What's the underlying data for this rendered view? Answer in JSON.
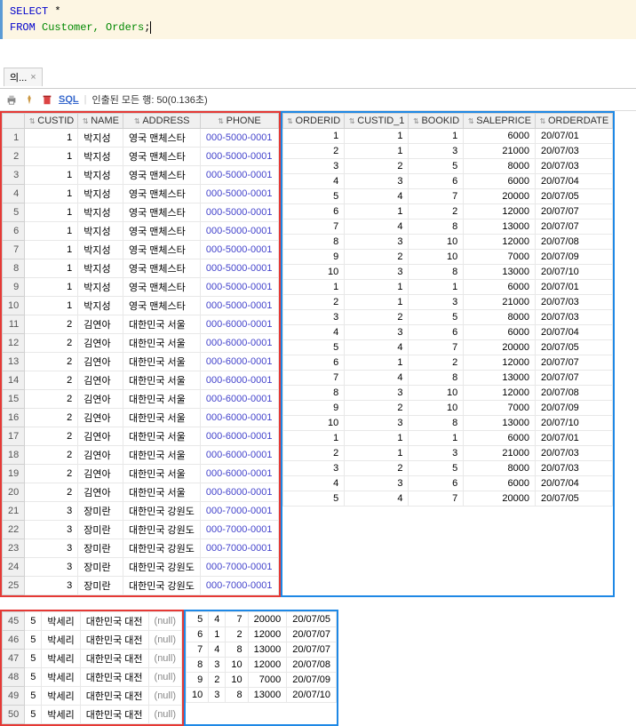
{
  "sql": {
    "line1_kw": "SELECT",
    "line1_rest": " *",
    "line2_kw": "FROM",
    "line2_tbls": " Customer, Orders",
    "line2_end": ";"
  },
  "tab": {
    "label": "의...",
    "close": "×"
  },
  "toolbar": {
    "sql": "SQL",
    "sep": "|",
    "status": "인출된 모든 행: 50(0.136초)"
  },
  "headers_left": [
    "CUSTID",
    "NAME",
    "ADDRESS",
    "PHONE"
  ],
  "headers_right": [
    "ORDERID",
    "CUSTID_1",
    "BOOKID",
    "SALEPRICE",
    "ORDERDATE"
  ],
  "rows1": [
    {
      "n": 1,
      "cid": 1,
      "nm": "박지성",
      "ad": "영국 맨체스타",
      "ph": "000-5000-0001",
      "oid": 1,
      "c1": 1,
      "bk": 1,
      "sp": 6000,
      "od": "20/07/01"
    },
    {
      "n": 2,
      "cid": 1,
      "nm": "박지성",
      "ad": "영국 맨체스타",
      "ph": "000-5000-0001",
      "oid": 2,
      "c1": 1,
      "bk": 3,
      "sp": 21000,
      "od": "20/07/03"
    },
    {
      "n": 3,
      "cid": 1,
      "nm": "박지성",
      "ad": "영국 맨체스타",
      "ph": "000-5000-0001",
      "oid": 3,
      "c1": 2,
      "bk": 5,
      "sp": 8000,
      "od": "20/07/03"
    },
    {
      "n": 4,
      "cid": 1,
      "nm": "박지성",
      "ad": "영국 맨체스타",
      "ph": "000-5000-0001",
      "oid": 4,
      "c1": 3,
      "bk": 6,
      "sp": 6000,
      "od": "20/07/04"
    },
    {
      "n": 5,
      "cid": 1,
      "nm": "박지성",
      "ad": "영국 맨체스타",
      "ph": "000-5000-0001",
      "oid": 5,
      "c1": 4,
      "bk": 7,
      "sp": 20000,
      "od": "20/07/05"
    },
    {
      "n": 6,
      "cid": 1,
      "nm": "박지성",
      "ad": "영국 맨체스타",
      "ph": "000-5000-0001",
      "oid": 6,
      "c1": 1,
      "bk": 2,
      "sp": 12000,
      "od": "20/07/07"
    },
    {
      "n": 7,
      "cid": 1,
      "nm": "박지성",
      "ad": "영국 맨체스타",
      "ph": "000-5000-0001",
      "oid": 7,
      "c1": 4,
      "bk": 8,
      "sp": 13000,
      "od": "20/07/07"
    },
    {
      "n": 8,
      "cid": 1,
      "nm": "박지성",
      "ad": "영국 맨체스타",
      "ph": "000-5000-0001",
      "oid": 8,
      "c1": 3,
      "bk": 10,
      "sp": 12000,
      "od": "20/07/08"
    },
    {
      "n": 9,
      "cid": 1,
      "nm": "박지성",
      "ad": "영국 맨체스타",
      "ph": "000-5000-0001",
      "oid": 9,
      "c1": 2,
      "bk": 10,
      "sp": 7000,
      "od": "20/07/09"
    },
    {
      "n": 10,
      "cid": 1,
      "nm": "박지성",
      "ad": "영국 맨체스타",
      "ph": "000-5000-0001",
      "oid": 10,
      "c1": 3,
      "bk": 8,
      "sp": 13000,
      "od": "20/07/10"
    },
    {
      "n": 11,
      "cid": 2,
      "nm": "김연아",
      "ad": "대한민국 서울",
      "ph": "000-6000-0001",
      "oid": 1,
      "c1": 1,
      "bk": 1,
      "sp": 6000,
      "od": "20/07/01"
    },
    {
      "n": 12,
      "cid": 2,
      "nm": "김연아",
      "ad": "대한민국 서울",
      "ph": "000-6000-0001",
      "oid": 2,
      "c1": 1,
      "bk": 3,
      "sp": 21000,
      "od": "20/07/03"
    },
    {
      "n": 13,
      "cid": 2,
      "nm": "김연아",
      "ad": "대한민국 서울",
      "ph": "000-6000-0001",
      "oid": 3,
      "c1": 2,
      "bk": 5,
      "sp": 8000,
      "od": "20/07/03"
    },
    {
      "n": 14,
      "cid": 2,
      "nm": "김연아",
      "ad": "대한민국 서울",
      "ph": "000-6000-0001",
      "oid": 4,
      "c1": 3,
      "bk": 6,
      "sp": 6000,
      "od": "20/07/04"
    },
    {
      "n": 15,
      "cid": 2,
      "nm": "김연아",
      "ad": "대한민국 서울",
      "ph": "000-6000-0001",
      "oid": 5,
      "c1": 4,
      "bk": 7,
      "sp": 20000,
      "od": "20/07/05"
    },
    {
      "n": 16,
      "cid": 2,
      "nm": "김연아",
      "ad": "대한민국 서울",
      "ph": "000-6000-0001",
      "oid": 6,
      "c1": 1,
      "bk": 2,
      "sp": 12000,
      "od": "20/07/07"
    },
    {
      "n": 17,
      "cid": 2,
      "nm": "김연아",
      "ad": "대한민국 서울",
      "ph": "000-6000-0001",
      "oid": 7,
      "c1": 4,
      "bk": 8,
      "sp": 13000,
      "od": "20/07/07"
    },
    {
      "n": 18,
      "cid": 2,
      "nm": "김연아",
      "ad": "대한민국 서울",
      "ph": "000-6000-0001",
      "oid": 8,
      "c1": 3,
      "bk": 10,
      "sp": 12000,
      "od": "20/07/08"
    },
    {
      "n": 19,
      "cid": 2,
      "nm": "김연아",
      "ad": "대한민국 서울",
      "ph": "000-6000-0001",
      "oid": 9,
      "c1": 2,
      "bk": 10,
      "sp": 7000,
      "od": "20/07/09"
    },
    {
      "n": 20,
      "cid": 2,
      "nm": "김연아",
      "ad": "대한민국 서울",
      "ph": "000-6000-0001",
      "oid": 10,
      "c1": 3,
      "bk": 8,
      "sp": 13000,
      "od": "20/07/10"
    },
    {
      "n": 21,
      "cid": 3,
      "nm": "장미란",
      "ad": "대한민국 강원도",
      "ph": "000-7000-0001",
      "oid": 1,
      "c1": 1,
      "bk": 1,
      "sp": 6000,
      "od": "20/07/01"
    },
    {
      "n": 22,
      "cid": 3,
      "nm": "장미란",
      "ad": "대한민국 강원도",
      "ph": "000-7000-0001",
      "oid": 2,
      "c1": 1,
      "bk": 3,
      "sp": 21000,
      "od": "20/07/03"
    },
    {
      "n": 23,
      "cid": 3,
      "nm": "장미란",
      "ad": "대한민국 강원도",
      "ph": "000-7000-0001",
      "oid": 3,
      "c1": 2,
      "bk": 5,
      "sp": 8000,
      "od": "20/07/03"
    },
    {
      "n": 24,
      "cid": 3,
      "nm": "장미란",
      "ad": "대한민국 강원도",
      "ph": "000-7000-0001",
      "oid": 4,
      "c1": 3,
      "bk": 6,
      "sp": 6000,
      "od": "20/07/04"
    },
    {
      "n": 25,
      "cid": 3,
      "nm": "장미란",
      "ad": "대한민국 강원도",
      "ph": "000-7000-0001",
      "oid": 5,
      "c1": 4,
      "bk": 7,
      "sp": 20000,
      "od": "20/07/05"
    }
  ],
  "rows2": [
    {
      "n": 45,
      "cid": 5,
      "nm": "박세리",
      "ad": "대한민국 대전",
      "ph": "(null)",
      "oid": 5,
      "c1": 4,
      "bk": 7,
      "sp": 20000,
      "od": "20/07/05"
    },
    {
      "n": 46,
      "cid": 5,
      "nm": "박세리",
      "ad": "대한민국 대전",
      "ph": "(null)",
      "oid": 6,
      "c1": 1,
      "bk": 2,
      "sp": 12000,
      "od": "20/07/07"
    },
    {
      "n": 47,
      "cid": 5,
      "nm": "박세리",
      "ad": "대한민국 대전",
      "ph": "(null)",
      "oid": 7,
      "c1": 4,
      "bk": 8,
      "sp": 13000,
      "od": "20/07/07"
    },
    {
      "n": 48,
      "cid": 5,
      "nm": "박세리",
      "ad": "대한민국 대전",
      "ph": "(null)",
      "oid": 8,
      "c1": 3,
      "bk": 10,
      "sp": 12000,
      "od": "20/07/08"
    },
    {
      "n": 49,
      "cid": 5,
      "nm": "박세리",
      "ad": "대한민국 대전",
      "ph": "(null)",
      "oid": 9,
      "c1": 2,
      "bk": 10,
      "sp": 7000,
      "od": "20/07/09"
    },
    {
      "n": 50,
      "cid": 5,
      "nm": "박세리",
      "ad": "대한민국 대전",
      "ph": "(null)",
      "oid": 10,
      "c1": 3,
      "bk": 8,
      "sp": 13000,
      "od": "20/07/10"
    }
  ]
}
